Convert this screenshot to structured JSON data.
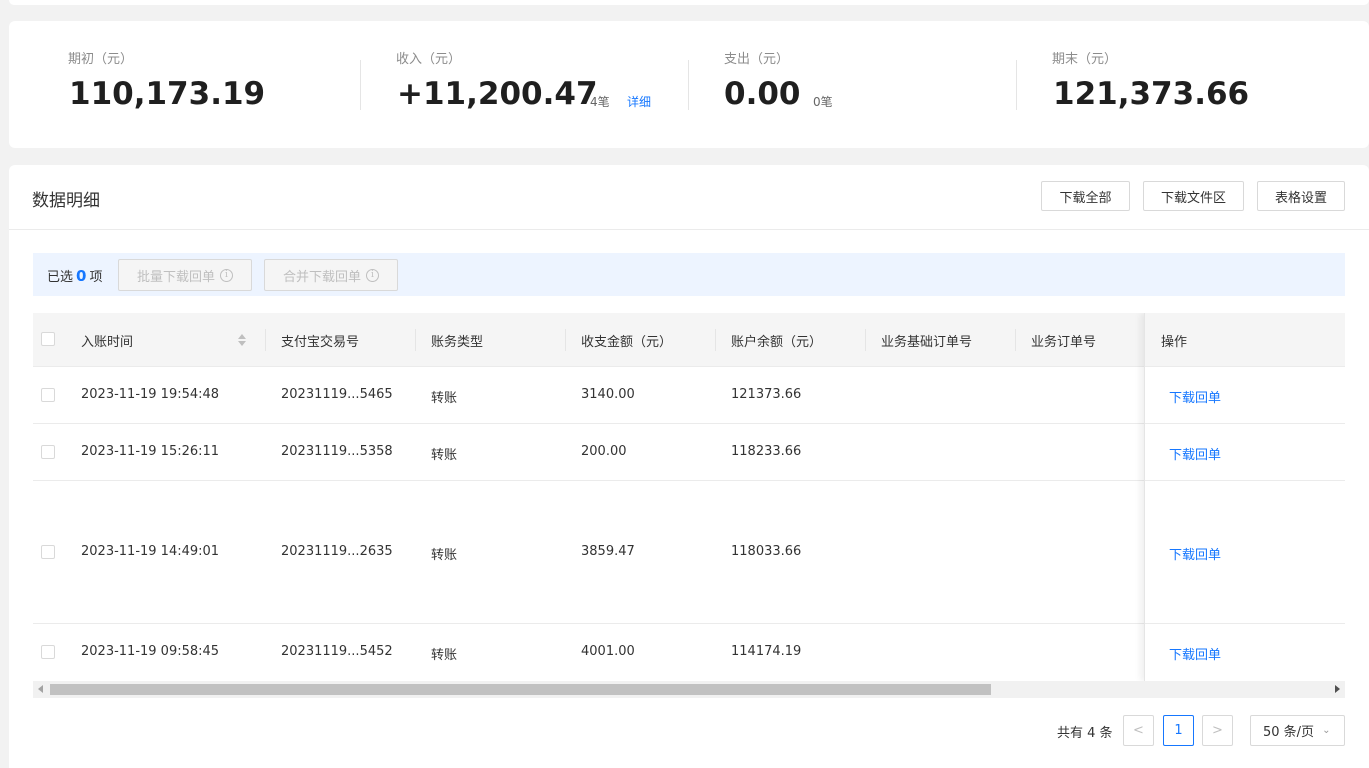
{
  "summary": {
    "opening": {
      "label": "期初（元）",
      "value": "110,173.19"
    },
    "income": {
      "label": "收入（元）",
      "value": "+11,200.47",
      "count": "4笔",
      "detail": "详细"
    },
    "expense": {
      "label": "支出（元）",
      "value": "0.00",
      "count": "0笔"
    },
    "closing": {
      "label": "期末（元）",
      "value": "121,373.66"
    }
  },
  "detail": {
    "title": "数据明细",
    "buttons": {
      "download_all": "下载全部",
      "download_files": "下载文件区",
      "table_settings": "表格设置"
    }
  },
  "selection": {
    "prefix": "已选",
    "count": "0",
    "suffix": "项",
    "batch_download": "批量下载回单",
    "merge_download": "合并下载回单"
  },
  "table": {
    "columns": [
      "入账时间",
      "支付宝交易号",
      "账务类型",
      "收支金额（元）",
      "账户余额（元）",
      "业务基础订单号",
      "业务订单号",
      "操作"
    ],
    "rows": [
      {
        "time": "2023-11-19 19:54:48",
        "trade_no": "20231119...5465",
        "type": "转账",
        "amount": "3140.00",
        "balance": "121373.66",
        "base_order": "",
        "order": "",
        "action": "下载回单"
      },
      {
        "time": "2023-11-19 15:26:11",
        "trade_no": "20231119...5358",
        "type": "转账",
        "amount": "200.00",
        "balance": "118233.66",
        "base_order": "",
        "order": "",
        "action": "下载回单"
      },
      {
        "time": "2023-11-19 14:49:01",
        "trade_no": "20231119...2635",
        "type": "转账",
        "amount": "3859.47",
        "balance": "118033.66",
        "base_order": "",
        "order": "",
        "action": "下载回单"
      },
      {
        "time": "2023-11-19 09:58:45",
        "trade_no": "20231119...5452",
        "type": "转账",
        "amount": "4001.00",
        "balance": "114174.19",
        "base_order": "",
        "order": "",
        "action": "下载回单"
      }
    ]
  },
  "pagination": {
    "total": "共有 4 条",
    "prev": "<",
    "current": "1",
    "next": ">",
    "page_size": "50 条/页"
  },
  "colors": {
    "accent": "#1677ff",
    "selection_bg": "#edf4ff"
  }
}
